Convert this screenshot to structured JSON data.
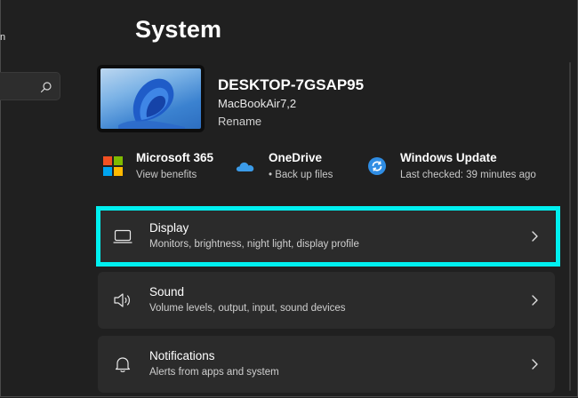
{
  "sidebar": {
    "fragment_text": "n",
    "search": {
      "placeholder": ""
    }
  },
  "header": {
    "title": "System"
  },
  "device": {
    "name": "DESKTOP-7GSAP95",
    "model": "MacBookAir7,2",
    "rename_label": "Rename"
  },
  "quick_cards": [
    {
      "title": "Microsoft 365",
      "subtitle": "View benefits",
      "icon": "microsoft-365-icon"
    },
    {
      "title": "OneDrive",
      "subtitle": "• Back up files",
      "icon": "onedrive-icon"
    },
    {
      "title": "Windows Update",
      "subtitle": "Last checked: 39 minutes ago",
      "icon": "windows-update-icon"
    }
  ],
  "settings": [
    {
      "title": "Display",
      "subtitle": "Monitors, brightness, night light, display profile",
      "icon": "monitor-icon",
      "highlighted": true
    },
    {
      "title": "Sound",
      "subtitle": "Volume levels, output, input, sound devices",
      "icon": "speaker-icon"
    },
    {
      "title": "Notifications",
      "subtitle": "Alerts from apps and system",
      "icon": "bell-icon"
    }
  ],
  "colors": {
    "background": "#202020",
    "card": "#2b2b2b",
    "highlight": "#00f0f0",
    "accent_blue": "#2f8de4"
  }
}
